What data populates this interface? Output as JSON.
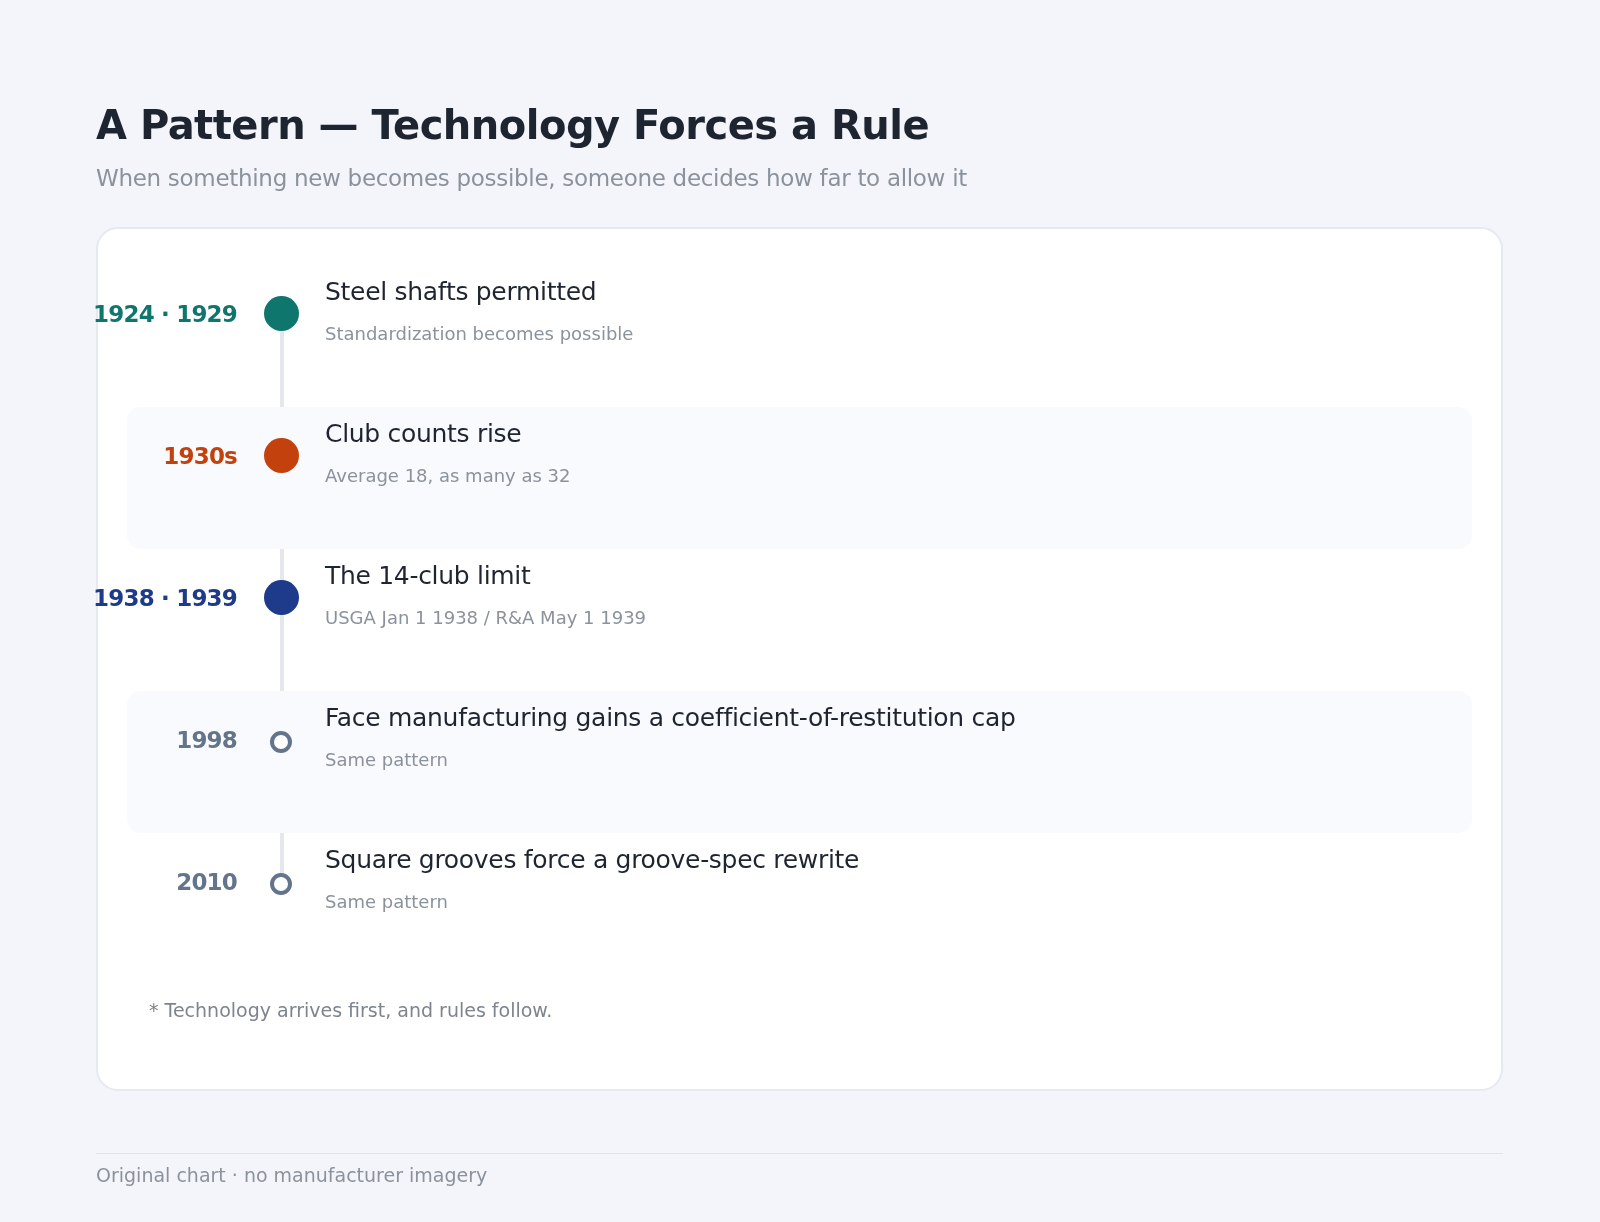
{
  "title": "A Pattern — Technology Forces a Rule",
  "subtitle": "When something new becomes possible, someone decides how far to allow it",
  "events": [
    {
      "period": "1924 · 1929",
      "title": "Steel shafts permitted",
      "detail": "Standardization becomes possible",
      "kind": "filled",
      "color": "#0f766e"
    },
    {
      "period": "1930s",
      "title": "Club counts rise",
      "detail": "Average 18, as many as 32",
      "kind": "filled",
      "color": "#c2410c"
    },
    {
      "period": "1938 · 1939",
      "title": "The 14-club limit",
      "detail": "USGA Jan 1 1938 / R&A May 1 1939",
      "kind": "filled",
      "color": "#1e3a8a"
    },
    {
      "period": "1998",
      "title": "Face manufacturing gains a coefficient-of-restitution cap",
      "detail": "Same pattern",
      "kind": "hollow",
      "color": "#64748b"
    },
    {
      "period": "2010",
      "title": "Square grooves force a groove-spec rewrite",
      "detail": "Same pattern",
      "kind": "hollow",
      "color": "#64748b"
    }
  ],
  "footnote": "* Technology arrives first, and rules follow.",
  "footer": "Original chart · no manufacturer imagery"
}
